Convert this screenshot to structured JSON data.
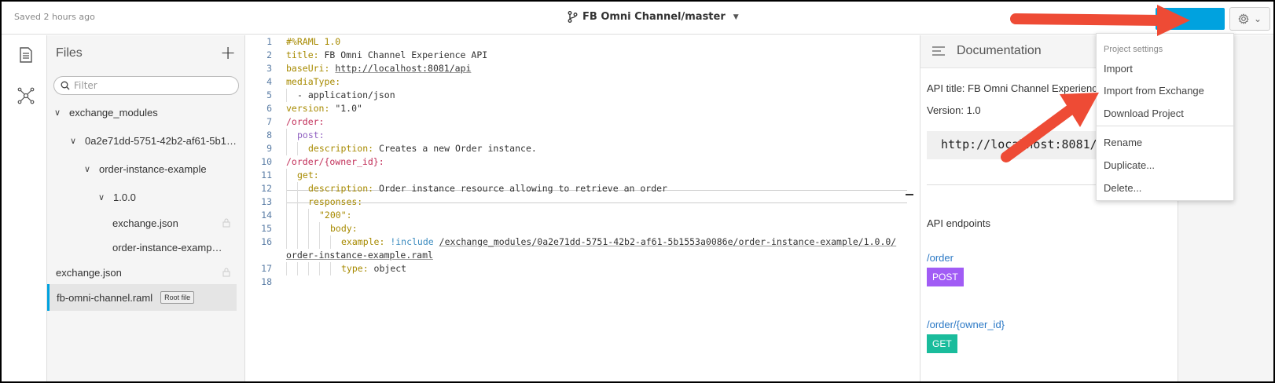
{
  "topbar": {
    "saved_text": "Saved 2 hours ago",
    "project_branch": "FB Omni Channel/master",
    "branch_icon": "git-branch-icon",
    "caret_icon": "chevron-down-icon",
    "settings_icon": "gear-icon",
    "settings_caret": "⌄"
  },
  "rail": {
    "items": [
      {
        "icon": "file-icon"
      },
      {
        "icon": "api-graph-icon"
      }
    ]
  },
  "files": {
    "title": "Files",
    "add_label": "+",
    "filter_placeholder": "Filter",
    "tree": [
      {
        "label": "exchange_modules",
        "expanded": true,
        "level": 0
      },
      {
        "label": "0a2e71dd-5751-42b2-af61-5b1…",
        "expanded": true,
        "level": 1
      },
      {
        "label": "order-instance-example",
        "expanded": true,
        "level": 2
      },
      {
        "label": "1.0.0",
        "expanded": true,
        "level": 3
      },
      {
        "label": "exchange.json",
        "locked": true,
        "level": 4
      },
      {
        "label": "order-instance-examp…",
        "locked": true,
        "level": 4
      },
      {
        "label": "exchange.json",
        "locked": true,
        "level": 0
      },
      {
        "label": "fb-omni-channel.raml",
        "selected": true,
        "level": 0,
        "badge": "Root file"
      }
    ]
  },
  "editor": {
    "line_numbers": [
      "1",
      "2",
      "3",
      "4",
      "5",
      "6",
      "7",
      "8",
      "9",
      "10",
      "11",
      "12",
      "13",
      "14",
      "15",
      "16",
      "",
      "17",
      "18"
    ],
    "l1": "#%RAML 1.0",
    "l2_key": "title:",
    "l2_val": " FB Omni Channel Experience API",
    "l3_key": "baseUri:",
    "l3_val": "http://localhost:8081/api",
    "l4_key": "mediaType:",
    "l5_val": "- application/json",
    "l6_key": "version:",
    "l6_val": " \"1.0\"",
    "l7_path": "/order:",
    "l8_meth": "post:",
    "l9_key": "description:",
    "l9_val": " Creates a new Order instance.",
    "l10_path": "/order/{owner_id}:",
    "l11_meth": "get:",
    "l12_key": "description:",
    "l12_val": " Order instance resource allowing to retrieve an order",
    "l13_key": "responses:",
    "l14_key": "\"200\":",
    "l15_key": "body:",
    "l16_key": "example:",
    "l16_inc": " !include ",
    "l16_val": "/exchange_modules/0a2e71dd-5751-42b2-af61-5b1553a0086e/order-instance-example/1.0.0/",
    "l16b_val": "order-instance-example.raml",
    "l17_key": "type:",
    "l17_val": " object"
  },
  "documentation": {
    "title": "Documentation",
    "menu_icon": "list-icon",
    "api_title": "API title: FB Omni Channel Experience API",
    "version": "Version: 1.0",
    "base_uri": "http://localhost:8081/api",
    "endpoints_heading": "API endpoints",
    "endpoints": [
      {
        "path": "/order",
        "method": "POST",
        "color": "#a15cf5"
      },
      {
        "path": "/order/{owner_id}",
        "method": "GET",
        "color": "#1abc9c"
      }
    ]
  },
  "settings_menu": {
    "heading": "Project settings",
    "items": [
      "Import",
      "Import from Exchange",
      "Download Project",
      "Rename",
      "Duplicate...",
      "Delete..."
    ]
  },
  "colors": {
    "accent": "#00a2df",
    "annotation_arrow": "#ee4b35"
  }
}
